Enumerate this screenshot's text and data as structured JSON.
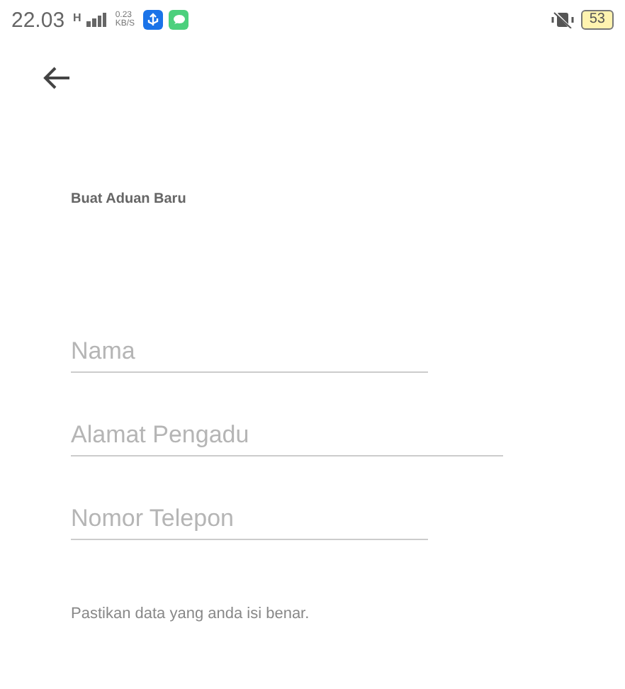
{
  "status_bar": {
    "time": "22.03",
    "network": "H",
    "speed_value": "0.23",
    "speed_unit": "KB/S",
    "battery": "53"
  },
  "title": "Buat Aduan Baru",
  "fields": [
    {
      "placeholder": "Nama"
    },
    {
      "placeholder": "Alamat Pengadu"
    },
    {
      "placeholder": "Nomor Telepon"
    }
  ],
  "note": "Pastikan data yang anda isi benar."
}
